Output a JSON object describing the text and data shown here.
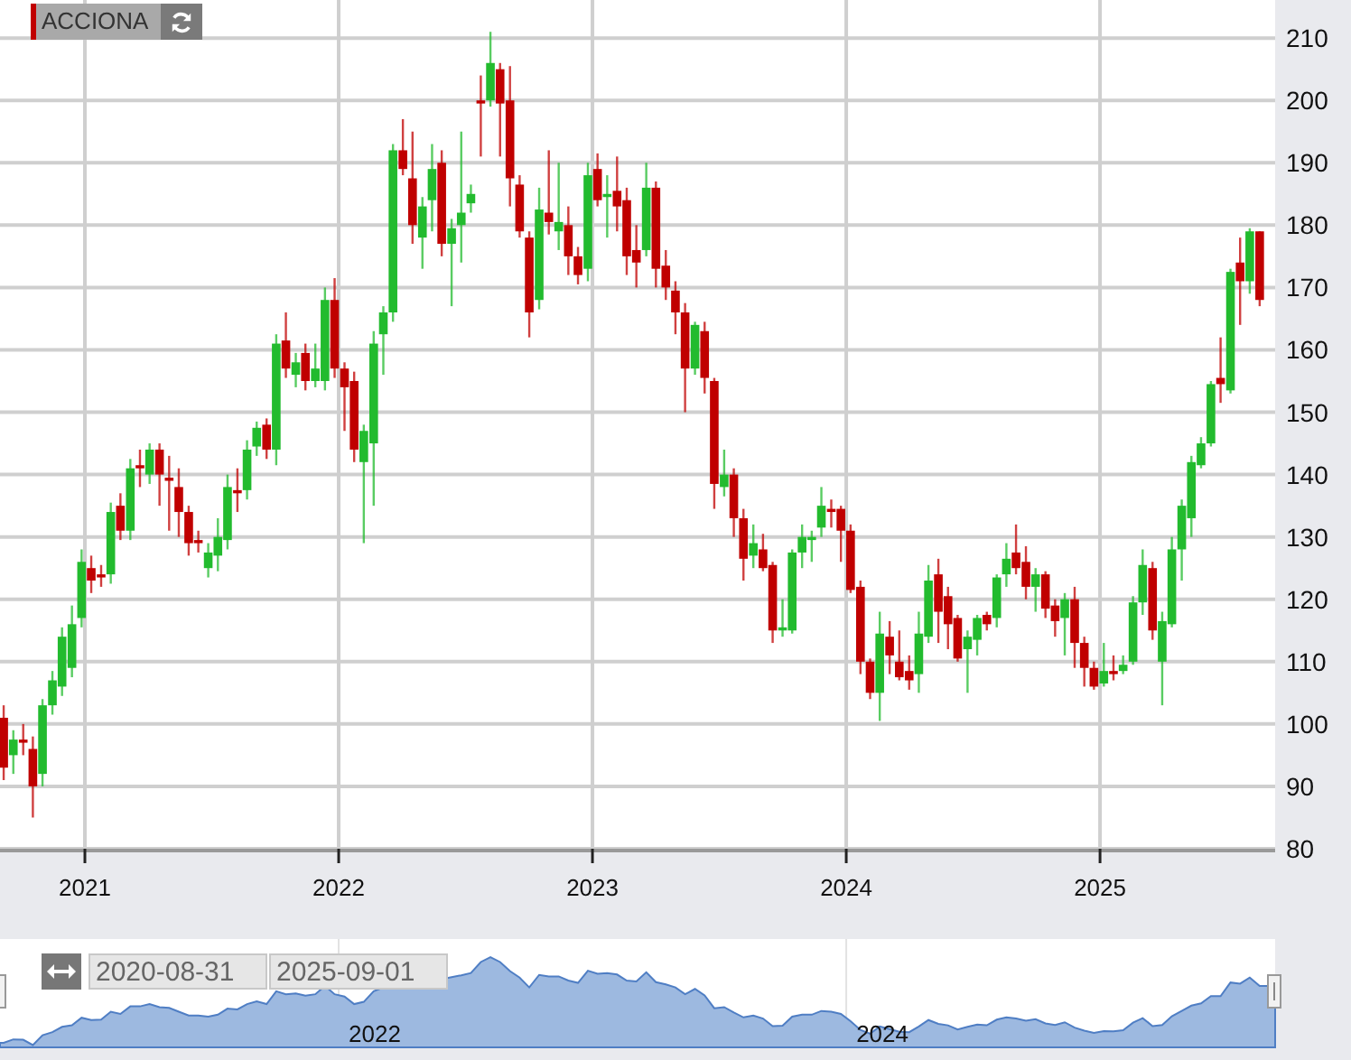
{
  "series_tag": {
    "label": "ACCIONA"
  },
  "chart": {
    "chart_data": {
      "type": "candlestick",
      "grid": true,
      "xlim": [
        2020.6655,
        2025.69
      ],
      "ylim": [
        80,
        216.1
      ],
      "xticks": [
        2021,
        2022,
        2023,
        2024,
        2025
      ],
      "yticks": [
        80,
        90,
        100,
        110,
        120,
        130,
        140,
        150,
        160,
        170,
        180,
        190,
        200,
        210
      ],
      "x": [
        2020.68,
        2020.718,
        2020.757,
        2020.795,
        2020.833,
        2020.872,
        2020.91,
        2020.949,
        2020.987,
        2021.025,
        2021.064,
        2021.102,
        2021.14,
        2021.179,
        2021.217,
        2021.255,
        2021.294,
        2021.332,
        2021.37,
        2021.409,
        2021.447,
        2021.486,
        2021.524,
        2021.562,
        2021.601,
        2021.639,
        2021.677,
        2021.716,
        2021.754,
        2021.792,
        2021.831,
        2021.869,
        2021.908,
        2021.946,
        2021.984,
        2022.023,
        2022.061,
        2022.099,
        2022.138,
        2022.176,
        2022.214,
        2022.253,
        2022.291,
        2022.33,
        2022.368,
        2022.406,
        2022.445,
        2022.483,
        2022.521,
        2022.56,
        2022.598,
        2022.636,
        2022.675,
        2022.713,
        2022.751,
        2022.79,
        2022.828,
        2022.867,
        2022.905,
        2022.943,
        2022.982,
        2023.02,
        2023.058,
        2023.097,
        2023.135,
        2023.173,
        2023.212,
        2023.25,
        2023.289,
        2023.327,
        2023.365,
        2023.404,
        2023.442,
        2023.48,
        2023.519,
        2023.557,
        2023.595,
        2023.634,
        2023.672,
        2023.71,
        2023.749,
        2023.787,
        2023.826,
        2023.864,
        2023.902,
        2023.941,
        2023.979,
        2024.017,
        2024.056,
        2024.094,
        2024.132,
        2024.171,
        2024.209,
        2024.248,
        2024.286,
        2024.324,
        2024.363,
        2024.401,
        2024.439,
        2024.478,
        2024.516,
        2024.554,
        2024.593,
        2024.631,
        2024.669,
        2024.708,
        2024.746,
        2024.785,
        2024.823,
        2024.861,
        2024.9,
        2024.938,
        2024.976,
        2025.015,
        2025.053,
        2025.091,
        2025.13,
        2025.168,
        2025.207,
        2025.245,
        2025.283,
        2025.322,
        2025.36,
        2025.398,
        2025.437,
        2025.475,
        2025.514,
        2025.552,
        2025.59,
        2025.629
      ],
      "ohlc": [
        [
          101,
          103,
          91,
          93
        ],
        [
          95,
          99,
          92,
          97.5
        ],
        [
          97.5,
          100,
          95,
          97
        ],
        [
          96,
          98,
          85,
          90
        ],
        [
          92,
          104,
          90,
          103
        ],
        [
          103,
          108.5,
          101.5,
          107
        ],
        [
          106,
          115.5,
          104.5,
          114
        ],
        [
          109,
          119,
          107.5,
          116
        ],
        [
          117,
          128,
          115.5,
          126
        ],
        [
          125,
          127,
          121,
          123
        ],
        [
          124,
          125.5,
          122,
          123.5
        ],
        [
          124,
          135.5,
          122.5,
          134
        ],
        [
          135,
          137,
          129.5,
          131
        ],
        [
          131,
          142.5,
          129.5,
          141
        ],
        [
          141.5,
          144,
          138,
          141
        ],
        [
          140,
          145,
          138.5,
          144
        ],
        [
          144,
          145,
          135,
          140
        ],
        [
          139.5,
          143,
          131,
          139
        ],
        [
          138,
          141,
          130,
          134
        ],
        [
          134,
          135,
          127,
          129
        ],
        [
          129.5,
          131,
          127.5,
          129
        ],
        [
          125,
          129,
          123.5,
          127.5
        ],
        [
          127,
          133,
          124.5,
          130
        ],
        [
          129.5,
          140,
          128,
          138
        ],
        [
          137.5,
          141,
          134,
          137
        ],
        [
          137.5,
          145.5,
          136,
          144
        ],
        [
          144.5,
          148.5,
          143,
          147.5
        ],
        [
          148,
          149,
          142.5,
          144
        ],
        [
          144,
          162.5,
          141.5,
          161
        ],
        [
          161.5,
          166,
          155.5,
          157
        ],
        [
          156,
          159.5,
          154,
          158
        ],
        [
          159.5,
          161,
          153.5,
          155
        ],
        [
          155,
          161,
          154,
          157
        ],
        [
          155,
          170,
          153.5,
          168
        ],
        [
          168,
          171.5,
          155.5,
          157
        ],
        [
          157,
          158,
          147,
          154
        ],
        [
          155,
          156.5,
          142,
          144
        ],
        [
          142,
          148,
          129,
          147
        ],
        [
          145,
          163,
          135,
          161
        ],
        [
          162.5,
          167,
          156,
          166
        ],
        [
          166,
          193,
          164.5,
          192
        ],
        [
          192,
          197,
          188,
          189
        ],
        [
          187.5,
          195,
          177,
          180
        ],
        [
          178,
          184.5,
          173,
          183
        ],
        [
          184,
          193,
          179,
          189
        ],
        [
          190,
          192,
          175,
          177
        ],
        [
          177,
          181,
          167,
          179.5
        ],
        [
          180,
          195,
          174,
          182
        ],
        [
          183.5,
          186.5,
          182,
          185
        ],
        [
          200,
          204,
          191,
          199.5
        ],
        [
          200,
          211,
          199,
          206
        ],
        [
          205,
          206,
          191,
          199.5
        ],
        [
          200,
          205.5,
          183,
          187.5
        ],
        [
          186.5,
          188,
          178,
          179
        ],
        [
          178,
          179,
          162,
          166
        ],
        [
          168,
          186,
          166.5,
          182.5
        ],
        [
          182,
          192,
          178.5,
          180.5
        ],
        [
          179,
          190,
          176,
          180.5
        ],
        [
          180,
          183,
          172,
          175
        ],
        [
          175,
          176.5,
          170.5,
          172
        ],
        [
          173,
          190,
          171,
          188
        ],
        [
          189,
          191.5,
          183,
          184
        ],
        [
          184.5,
          188,
          178,
          185
        ],
        [
          185.5,
          191,
          179,
          183
        ],
        [
          184,
          186,
          172,
          175
        ],
        [
          176,
          180,
          170,
          174
        ],
        [
          176,
          190,
          175,
          186
        ],
        [
          186,
          187,
          170,
          173
        ],
        [
          173.5,
          176,
          168,
          170
        ],
        [
          169.5,
          171,
          162.5,
          166
        ],
        [
          166,
          167.5,
          150,
          157
        ],
        [
          157,
          164.5,
          156,
          164
        ],
        [
          163,
          164.5,
          153,
          155.5
        ],
        [
          155,
          155.5,
          134.5,
          138.5
        ],
        [
          138,
          144,
          136.5,
          140
        ],
        [
          140,
          141,
          130,
          133
        ],
        [
          133,
          134.5,
          123,
          126.5
        ],
        [
          127,
          132,
          125,
          129
        ],
        [
          128,
          130.5,
          124.5,
          125
        ],
        [
          125.5,
          126,
          113,
          115
        ],
        [
          115,
          120,
          114,
          115.5
        ],
        [
          115,
          128,
          114.5,
          127.5
        ],
        [
          127.5,
          132,
          125,
          130
        ],
        [
          129.5,
          131,
          126,
          130
        ],
        [
          131.5,
          138,
          130,
          135
        ],
        [
          134.5,
          136,
          131.5,
          134
        ],
        [
          134.5,
          135,
          126,
          131
        ],
        [
          131,
          132,
          121,
          121.5
        ],
        [
          122,
          123,
          108,
          110
        ],
        [
          110,
          110.5,
          104,
          105
        ],
        [
          105,
          118,
          100.5,
          114.5
        ],
        [
          114,
          116.5,
          108,
          111
        ],
        [
          110,
          115,
          107,
          107.5
        ],
        [
          108.5,
          111,
          105.5,
          107
        ],
        [
          108,
          118,
          105,
          114.5
        ],
        [
          114,
          125.5,
          113,
          123
        ],
        [
          124,
          126.5,
          113,
          118
        ],
        [
          120.5,
          122,
          112,
          116
        ],
        [
          117,
          117.5,
          110,
          110.5
        ],
        [
          112,
          115,
          105,
          114
        ],
        [
          113.5,
          117.5,
          111,
          117
        ],
        [
          117.5,
          118,
          115,
          116
        ],
        [
          117,
          124,
          115.5,
          123.5
        ],
        [
          124,
          129,
          122,
          126.5
        ],
        [
          127.5,
          132,
          124,
          125
        ],
        [
          126,
          128.5,
          120,
          122
        ],
        [
          122,
          125,
          118,
          124
        ],
        [
          124,
          124.5,
          117,
          118.5
        ],
        [
          119,
          120,
          114,
          116.5
        ],
        [
          117,
          121,
          111,
          120
        ],
        [
          120,
          122,
          109,
          113
        ],
        [
          113,
          114,
          106,
          109
        ],
        [
          109,
          110,
          105.5,
          106
        ],
        [
          106.5,
          113,
          106,
          108.5
        ],
        [
          108.5,
          111,
          107,
          108
        ],
        [
          108.5,
          111,
          108,
          109.5
        ],
        [
          110,
          120.5,
          109.5,
          119.5
        ],
        [
          119.5,
          128,
          117.5,
          125.5
        ],
        [
          125,
          126,
          113.5,
          115
        ],
        [
          110,
          118,
          103,
          116.5
        ],
        [
          116,
          130,
          115.5,
          128
        ],
        [
          128,
          136,
          123,
          135
        ],
        [
          133,
          143,
          130,
          142
        ],
        [
          141.5,
          146,
          141,
          145
        ],
        [
          145,
          155,
          144.5,
          154.5
        ],
        [
          155.5,
          162,
          151.5,
          154.5
        ],
        [
          153.5,
          173,
          153,
          172.5
        ],
        [
          174,
          178,
          164,
          171
        ],
        [
          171,
          179.5,
          169,
          179
        ],
        [
          179,
          179,
          167,
          168
        ]
      ]
    }
  },
  "navigator": {
    "start_date": "2020-08-31",
    "end_date": "2025-09-01",
    "axis_labels": [
      "2022",
      "2024"
    ]
  }
}
